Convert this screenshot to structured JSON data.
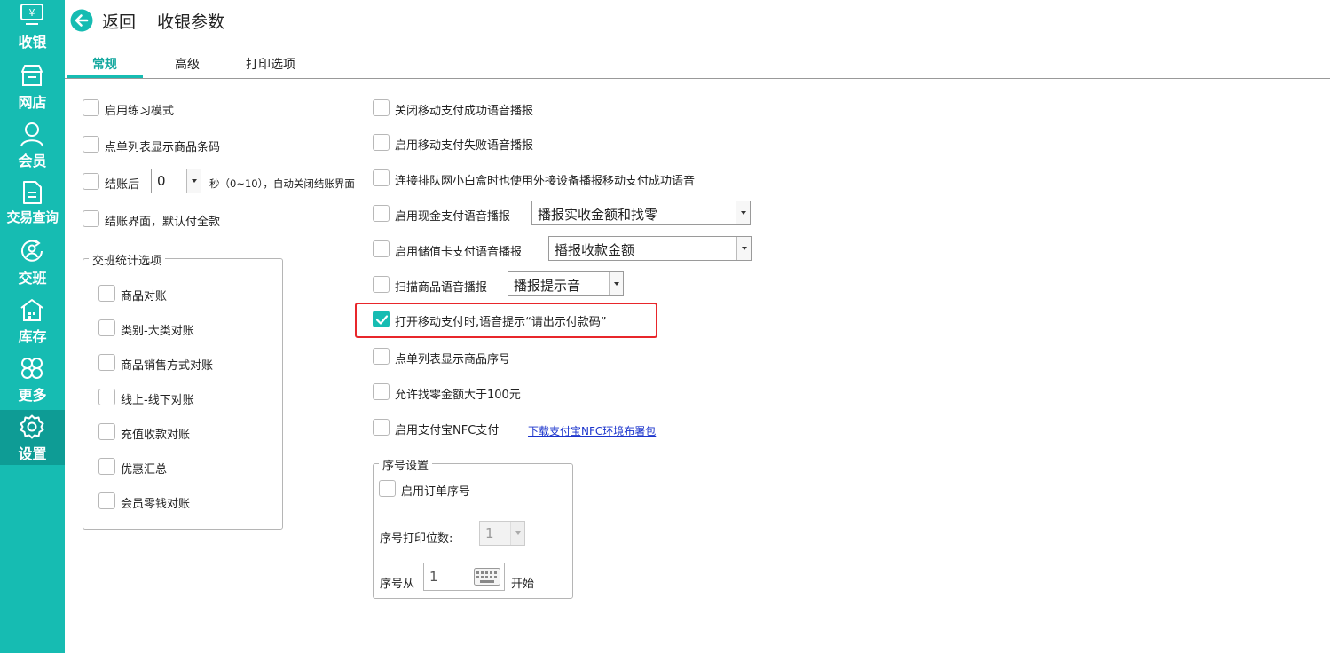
{
  "sidebar": {
    "items": [
      {
        "label": "收银",
        "icon": "cashier-icon"
      },
      {
        "label": "网店",
        "icon": "store-icon"
      },
      {
        "label": "会员",
        "icon": "member-icon"
      },
      {
        "label": "交易查询",
        "icon": "document-icon"
      },
      {
        "label": "交班",
        "icon": "shift-icon"
      },
      {
        "label": "库存",
        "icon": "warehouse-icon"
      },
      {
        "label": "更多",
        "icon": "clover-icon"
      },
      {
        "label": "设置",
        "icon": "gear-icon",
        "active": true
      }
    ]
  },
  "header": {
    "back_label": "返回",
    "title": "收银参数"
  },
  "tabs": [
    {
      "label": "常规",
      "active": true
    },
    {
      "label": "高级"
    },
    {
      "label": "打印选项"
    }
  ],
  "left": {
    "practice_mode": "启用练习模式",
    "show_barcode": "点单列表显示商品条码",
    "after_checkout_prefix": "结账后",
    "after_checkout_seconds": "0",
    "after_checkout_suffix": "秒（0~10），自动关闭结账界面",
    "default_full_payment": "结账界面，默认付全款"
  },
  "shift_group": {
    "title": "交班统计选项",
    "items": [
      "商品对账",
      "类别-大类对账",
      "商品销售方式对账",
      "线上-线下对账",
      "充值收款对账",
      "优惠汇总",
      "会员零钱对账"
    ]
  },
  "right": {
    "close_mobile_success_voice": "关闭移动支付成功语音播报",
    "enable_mobile_fail_voice": "启用移动支付失败语音播报",
    "external_device_voice": "连接排队网小白盒时也使用外接设备播报移动支付成功语音",
    "cash_voice": "启用现金支付语音播报",
    "cash_voice_select": "播报实收金额和找零",
    "stored_card_voice": "启用储值卡支付语音播报",
    "stored_card_voice_select": "播报收款金额",
    "scan_voice": "扫描商品语音播报",
    "scan_voice_select": "播报提示音",
    "open_mobile_pay_prompt": "打开移动支付时,语音提示“请出示付款码”",
    "show_serial": "点单列表显示商品序号",
    "allow_change_over_100": "允许找零金额大于100元",
    "alipay_nfc": "启用支付宝NFC支付",
    "alipay_nfc_link": "下载支付宝NFC环境布署包"
  },
  "serial_group": {
    "title": "序号设置",
    "enable_order_serial": "启用订单序号",
    "digits_label": "序号打印位数:",
    "digits_value": "1",
    "start_prefix": "序号从",
    "start_value": "1",
    "start_suffix": "开始"
  },
  "colors": {
    "brand": "#16bcb2",
    "highlight": "#e8262b",
    "link": "#1a33cc"
  }
}
